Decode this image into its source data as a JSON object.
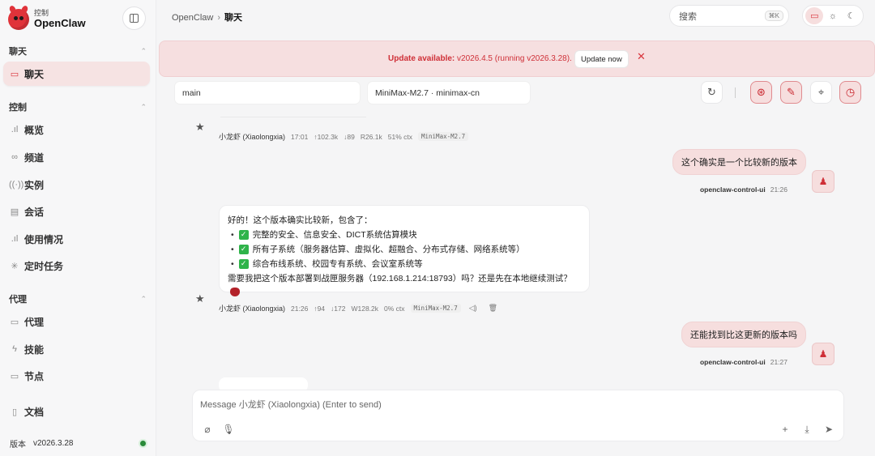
{
  "app": {
    "brand_sub": "控制",
    "brand_name": "OpenClaw"
  },
  "sidebar": {
    "sections": [
      {
        "label": "聊天"
      },
      {
        "label": "控制"
      },
      {
        "label": "代理"
      }
    ],
    "items": [
      {
        "label": "聊天",
        "icon": "chat-icon"
      },
      {
        "label": "概览",
        "icon": "chart-icon"
      },
      {
        "label": "频道",
        "icon": "link-icon"
      },
      {
        "label": "实例",
        "icon": "broadcast-icon"
      },
      {
        "label": "会话",
        "icon": "document-icon"
      },
      {
        "label": "使用情况",
        "icon": "chart-icon"
      },
      {
        "label": "定时任务",
        "icon": "loader-icon"
      },
      {
        "label": "代理",
        "icon": "folder-icon"
      },
      {
        "label": "技能",
        "icon": "bolt-icon"
      },
      {
        "label": "节点",
        "icon": "monitor-icon"
      },
      {
        "label": "文档",
        "icon": "book-icon"
      }
    ],
    "version_key": "版本",
    "version_value": "v2026.3.28",
    "status_color": "#2a8a3a"
  },
  "topbar": {
    "breadcrumb_root": "OpenClaw",
    "breadcrumb_sep": "›",
    "breadcrumb_current": "聊天",
    "search_label": "搜索",
    "search_shortcut": "⌘K",
    "theme_options": [
      "monitor-icon",
      "sun-icon",
      "moon-icon"
    ]
  },
  "banner": {
    "title": "Update available:",
    "message": " v2026.4.5 (running v2026.3.28).",
    "button": "Update now",
    "close": "✕"
  },
  "toolbar": {
    "session_value": "main",
    "model_value": "MiniMax-M2.7 · minimax-cn"
  },
  "chat": {
    "assistant_name": "小龙虾 (Xiaolongxia)",
    "model_tag": "MiniMax-M2.7",
    "msg1_meta": {
      "time": "17:01",
      "in": "↑102.3k",
      "out": "↓89",
      "cache": "R26.1k",
      "ctx": "51% ctx"
    },
    "user1": {
      "text": "这个确实是一个比较新的版本",
      "sender": "openclaw-control-ui",
      "time": "21:26"
    },
    "assistant2": {
      "intro": "好的！这个版本确实比较新，包含了：",
      "items": [
        "完整的安全、信息安全、DICT系统估算模块",
        "所有子系统（服务器估算、虚拟化、超融合、分布式存储、网络系统等）",
        "综合布线系统、校园专有系统、会议室系统等"
      ],
      "outro": "需要我把这个版本部署到战匣服务器（192.168.1.214:18793）吗？还是先在本地继续测试？"
    },
    "msg2_meta": {
      "time": "21:26",
      "in": "↑94",
      "out": "↓172",
      "cache": "W128.2k",
      "ctx": "0% ctx"
    },
    "user2": {
      "text": "还能找到比这更新的版本吗",
      "sender": "openclaw-control-ui",
      "time": "21:27"
    }
  },
  "composer": {
    "placeholder": "Message 小龙虾 (Xiaolongxia) (Enter to send)"
  },
  "colors": {
    "accent": "#d9363e",
    "banner_bg": "#f6dfe0",
    "user_bubble": "#f6dede"
  }
}
